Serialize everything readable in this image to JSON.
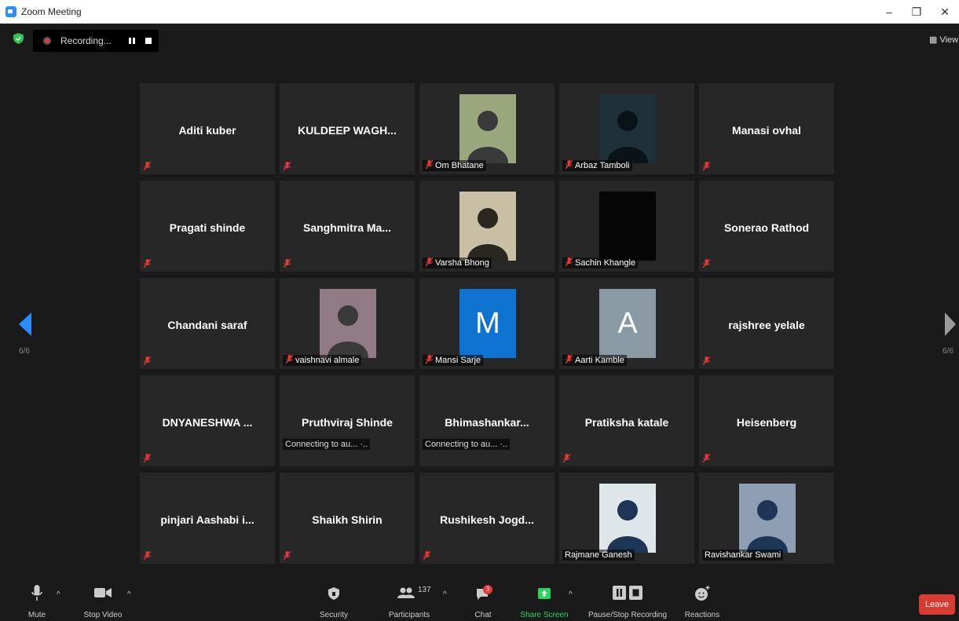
{
  "window": {
    "title": "Zoom Meeting",
    "controls": {
      "minimize": "–",
      "restore": "❐",
      "close": "✕"
    }
  },
  "recording": {
    "status": "Recording..."
  },
  "view_button": {
    "label": "View",
    "icon": "grid-icon"
  },
  "pagination": {
    "left": "6/6",
    "right": "6/6"
  },
  "tiles": [
    {
      "name": "Aditi kuber",
      "muted": true
    },
    {
      "name": "KULDEEP  WAGH...",
      "muted": true
    },
    {
      "caption": "Om Bhatane",
      "muted": true,
      "media": "photo",
      "media_color": "#9aa77d"
    },
    {
      "caption": "Arbaz Tamboli",
      "muted": true,
      "media": "hooded-figure",
      "media_color": "#1e3038"
    },
    {
      "name": "Manasi ovhal",
      "muted": true
    },
    {
      "name": "Pragati shinde",
      "muted": true
    },
    {
      "name": "Sanghmitra  Ma...",
      "muted": true
    },
    {
      "caption": "Varsha Bhong",
      "muted": true,
      "media": "sketch",
      "media_color": "#c9bfa5"
    },
    {
      "caption": "Sachin Khangle",
      "muted": true,
      "media": "black",
      "media_color": "#050505"
    },
    {
      "name": "Sonerao Rathod",
      "muted": true
    },
    {
      "name": "Chandani saraf",
      "muted": true
    },
    {
      "caption": "vaishnavi almale",
      "muted": true,
      "media": "photo",
      "media_color": "#8f7a85"
    },
    {
      "caption": "Mansi Sarje",
      "muted": true,
      "media": "letter",
      "letter": "M",
      "media_color": "#0e72d1"
    },
    {
      "caption": "Aarti Kamble",
      "muted": true,
      "media": "letter",
      "letter": "A",
      "media_color": "#8a9aa5"
    },
    {
      "name": "rajshree yelale",
      "muted": true
    },
    {
      "name": "DNYANESHWA ...",
      "muted": true
    },
    {
      "name": "Pruthviraj Shinde",
      "connecting": "Connecting to au... ·..",
      "muted": false
    },
    {
      "name": "Bhimashankar...",
      "connecting": "Connecting to au... ·..",
      "muted": false
    },
    {
      "name": "Pratiksha katale",
      "muted": true
    },
    {
      "name": "Heisenberg",
      "muted": true
    },
    {
      "name": "pinjari  Aashabi  i...",
      "muted": true
    },
    {
      "name": "Shaikh Shirin",
      "muted": true
    },
    {
      "name": "Rushikesh  Jogd...",
      "muted": true
    },
    {
      "caption": "Rajmane Ganesh",
      "muted": false,
      "media": "portrait",
      "media_color": "#dfe6ea"
    },
    {
      "caption": "Ravishankar Swami",
      "muted": false,
      "media": "portrait",
      "media_color": "#8e9fb3"
    }
  ],
  "toolbar": {
    "mute": "Mute",
    "stop_video": "Stop Video",
    "security": "Security",
    "participants": "Participants",
    "participants_count": "137",
    "chat": "Chat",
    "chat_badge": "3",
    "share_screen": "Share Screen",
    "pause_recording": "Pause/Stop Recording",
    "reactions": "Reactions",
    "leave": "Leave"
  },
  "colors": {
    "accent": "#2d8cff",
    "share_green": "#23d959",
    "leave_red": "#d93b30",
    "mute_red": "#e53935"
  }
}
